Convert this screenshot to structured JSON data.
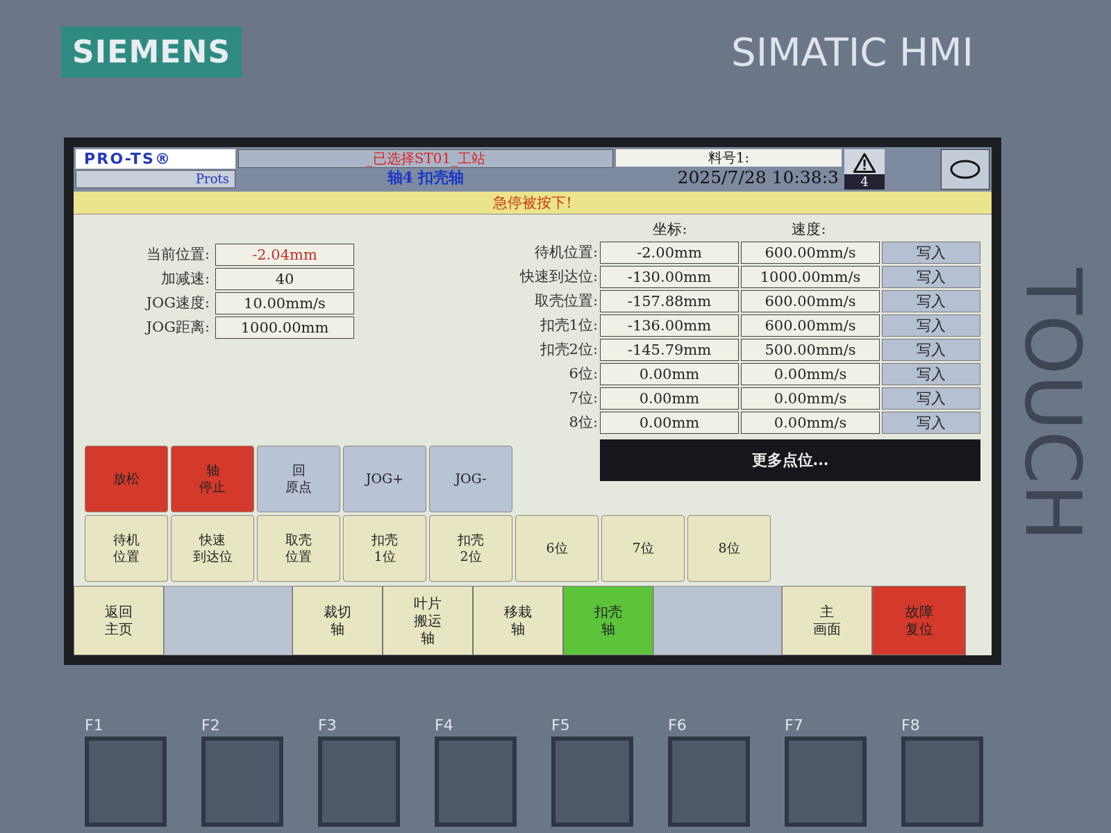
{
  "bezel": {
    "brand": "SIEMENS",
    "model": "SIMATIC HMI",
    "side_label": "TOUCH",
    "function_keys": [
      "F1",
      "F2",
      "F3",
      "F4",
      "F5",
      "F6",
      "F7",
      "F8"
    ]
  },
  "header": {
    "logo": "PRO-TS®",
    "logo_sub": "Prots",
    "station": "_已选择ST01_工站",
    "axis": "轴4  扣壳轴",
    "part_label": "料号1:",
    "datetime": "2025/7/28 10:38:3",
    "alarm_count": "4"
  },
  "alert": "急停被按下!",
  "params": [
    {
      "label": "当前位置:",
      "value": "-2.04mm",
      "highlight": true
    },
    {
      "label": "加减速:",
      "value": "40",
      "highlight": false
    },
    {
      "label": "JOG速度:",
      "value": "10.00mm/s",
      "highlight": false
    },
    {
      "label": "JOG距离:",
      "value": "1000.00mm",
      "highlight": false
    }
  ],
  "table": {
    "columns": [
      "坐标:",
      "速度:"
    ],
    "rows": [
      {
        "label": "待机位置:",
        "coord": "-2.00mm",
        "speed": "600.00mm/s",
        "button": "写入"
      },
      {
        "label": "快速到达位:",
        "coord": "-130.00mm",
        "speed": "1000.00mm/s",
        "button": "写入"
      },
      {
        "label": "取壳位置:",
        "coord": "-157.88mm",
        "speed": "600.00mm/s",
        "button": "写入"
      },
      {
        "label": "扣壳1位:",
        "coord": "-136.00mm",
        "speed": "600.00mm/s",
        "button": "写入"
      },
      {
        "label": "扣壳2位:",
        "coord": "-145.79mm",
        "speed": "500.00mm/s",
        "button": "写入"
      },
      {
        "label": "6位:",
        "coord": "0.00mm",
        "speed": "0.00mm/s",
        "button": "写入"
      },
      {
        "label": "7位:",
        "coord": "0.00mm",
        "speed": "0.00mm/s",
        "button": "写入"
      },
      {
        "label": "8位:",
        "coord": "0.00mm",
        "speed": "0.00mm/s",
        "button": "写入"
      }
    ]
  },
  "more_button": "更多点位...",
  "control_buttons": [
    {
      "label": [
        "放松"
      ],
      "color": "#d33a2c"
    },
    {
      "label": [
        "轴",
        "停止"
      ],
      "color": "#d33a2c"
    },
    {
      "label": [
        "回",
        "原点"
      ],
      "color": "#b8c3d6"
    },
    {
      "label": [
        "JOG+"
      ],
      "color": "#b8c3d6"
    },
    {
      "label": [
        "JOG-"
      ],
      "color": "#b8c3d6"
    }
  ],
  "position_buttons": [
    [
      "待机",
      "位置"
    ],
    [
      "快速",
      "到达位"
    ],
    [
      "取壳",
      "位置"
    ],
    [
      "扣壳",
      "1位"
    ],
    [
      "扣壳",
      "2位"
    ],
    [
      "6位"
    ],
    [
      "7位"
    ],
    [
      "8位"
    ]
  ],
  "nav": [
    {
      "kind": "button",
      "label": [
        "返回",
        "主页"
      ],
      "selected": false
    },
    {
      "kind": "blank",
      "selected": false
    },
    {
      "kind": "button",
      "label": [
        "裁切",
        "轴"
      ],
      "selected": false
    },
    {
      "kind": "button",
      "label": [
        "叶片",
        "搬运",
        "轴"
      ],
      "selected": false
    },
    {
      "kind": "button",
      "label": [
        "移栽",
        "轴"
      ],
      "selected": false
    },
    {
      "kind": "button",
      "label": [
        "扣壳",
        "轴"
      ],
      "selected": true
    },
    {
      "kind": "blank",
      "selected": false
    },
    {
      "kind": "button",
      "label": [
        "主",
        "画面"
      ],
      "selected": false
    },
    {
      "kind": "alarm",
      "label": [
        "故障",
        "复位"
      ],
      "selected": false
    }
  ]
}
